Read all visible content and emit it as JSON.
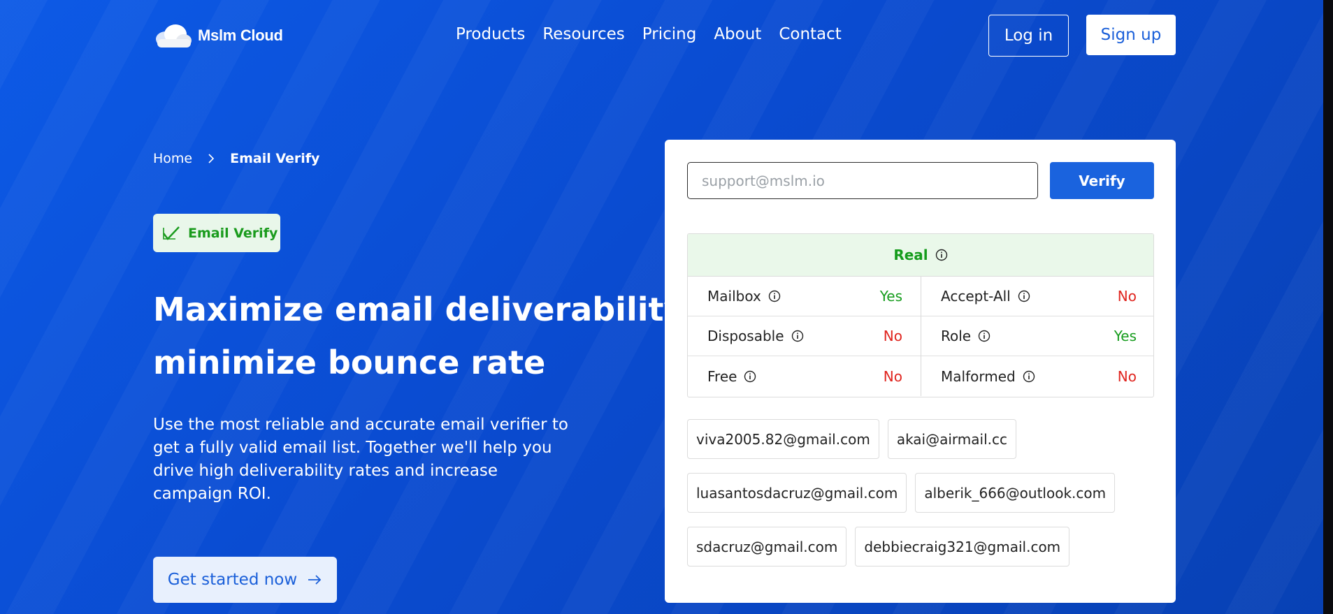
{
  "brand": {
    "name": "Mslm Cloud"
  },
  "nav": {
    "items": [
      "Products",
      "Resources",
      "Pricing",
      "About",
      "Contact"
    ],
    "login_label": "Log in",
    "signup_label": "Sign up"
  },
  "breadcrumb": {
    "home": "Home",
    "current": "Email Verify"
  },
  "badge": {
    "label": "Email Verify",
    "icon": "check-mark-icon"
  },
  "headline": {
    "line1_bold": "Maximize",
    "line1_rest": " email deliverability,",
    "line2_bold": "minimize",
    "line2_rest": " bounce rate"
  },
  "description": "Use the most reliable and accurate email verifier to get a fully valid email list. Together we'll help you drive high deliverability rates and increase campaign ROI.",
  "cta": {
    "label": "Get started now"
  },
  "verifier": {
    "input_placeholder": "support@mslm.io",
    "input_value": "",
    "verify_label": "Verify",
    "result_status": "Real",
    "checks": [
      {
        "label": "Mailbox",
        "value": "Yes",
        "status": "yes"
      },
      {
        "label": "Accept-All",
        "value": "No",
        "status": "no"
      },
      {
        "label": "Disposable",
        "value": "No",
        "status": "no"
      },
      {
        "label": "Role",
        "value": "Yes",
        "status": "yes"
      },
      {
        "label": "Free",
        "value": "No",
        "status": "no"
      },
      {
        "label": "Malformed",
        "value": "No",
        "status": "no"
      }
    ],
    "sample_emails": [
      [
        "viva2005.82@gmail.com",
        "akai@airmail.cc"
      ],
      [
        "luasantosdacruz@gmail.com",
        "alberik_666@outlook.com"
      ],
      [
        "sdacruz@gmail.com",
        "debbiecraig321@gmail.com"
      ]
    ]
  },
  "colors": {
    "background": "#0a4fd6",
    "accent": "#1a63de",
    "success": "#159c1c",
    "danger": "#e0241e"
  }
}
